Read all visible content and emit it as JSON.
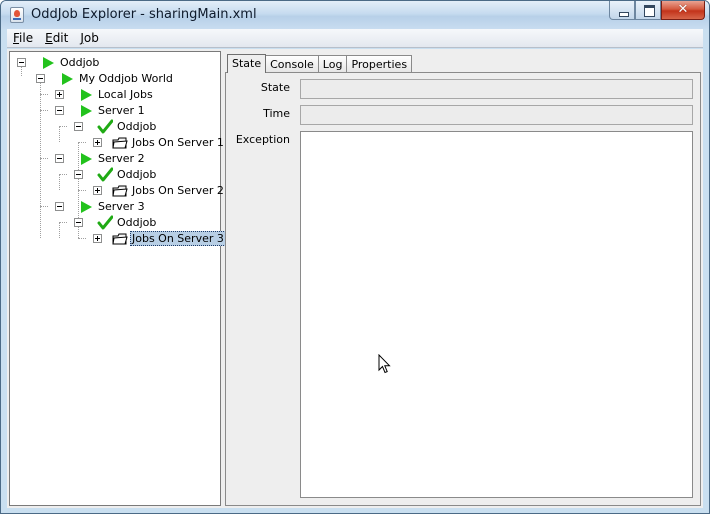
{
  "window": {
    "title": "OddJob Explorer - sharingMain.xml",
    "controls": {
      "close_glyph": "✕"
    }
  },
  "menu": {
    "items": [
      {
        "label": "File"
      },
      {
        "label": "Edit"
      },
      {
        "label": "Job"
      }
    ]
  },
  "tree": {
    "nodes": [
      {
        "label": "Oddjob",
        "icon": "play-icon",
        "expanded": true
      },
      {
        "label": "My Oddjob World",
        "icon": "play-icon",
        "expanded": true
      },
      {
        "label": "Local Jobs",
        "icon": "play-icon",
        "expanded": false
      },
      {
        "label": "Server 1",
        "icon": "play-icon",
        "expanded": true
      },
      {
        "label": "Oddjob",
        "icon": "check-icon",
        "expanded": true
      },
      {
        "label": "Jobs On Server 1",
        "icon": "folder-icon",
        "expanded": false
      },
      {
        "label": "Server 2",
        "icon": "play-icon",
        "expanded": true
      },
      {
        "label": "Oddjob",
        "icon": "check-icon",
        "expanded": true
      },
      {
        "label": "Jobs On Server 2",
        "icon": "folder-icon",
        "expanded": false
      },
      {
        "label": "Server 3",
        "icon": "play-icon",
        "expanded": true
      },
      {
        "label": "Oddjob",
        "icon": "check-icon",
        "expanded": true
      },
      {
        "label": "Jobs On Server 3",
        "icon": "folder-icon",
        "expanded": false,
        "selected": true
      }
    ]
  },
  "tabs": [
    {
      "label": "State",
      "active": true
    },
    {
      "label": "Console",
      "active": false
    },
    {
      "label": "Log",
      "active": false
    },
    {
      "label": "Properties",
      "active": false
    }
  ],
  "state_panel": {
    "state_label": "State",
    "state_value": "",
    "time_label": "Time",
    "time_value": "",
    "exception_label": "Exception",
    "exception_value": ""
  },
  "colors": {
    "play": "#22c21c",
    "check": "#1faa14",
    "selection": "#b8cfe5"
  }
}
